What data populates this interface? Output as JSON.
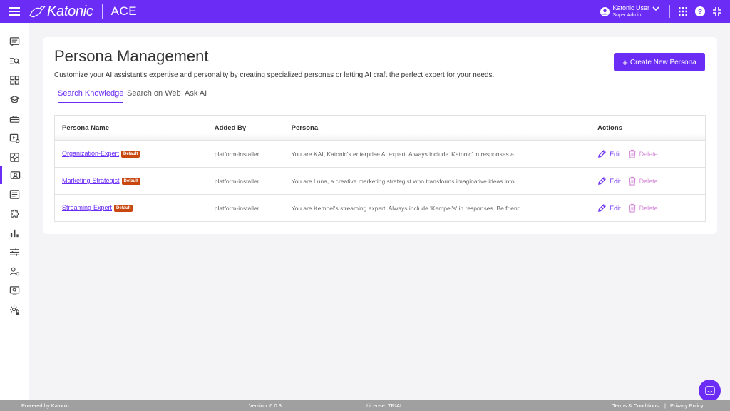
{
  "header": {
    "logo_text": "Katonic",
    "app_name": "ACE",
    "user_name": "Katonic User",
    "user_role": "Super Admin",
    "brand_color": "#6b2cf5"
  },
  "sidebar": {
    "items": [
      {
        "icon": "chat-icon"
      },
      {
        "icon": "search-list-icon"
      },
      {
        "icon": "grid-icon"
      },
      {
        "icon": "graduation-cap-icon"
      },
      {
        "icon": "toolbox-icon"
      },
      {
        "icon": "video-settings-icon"
      },
      {
        "icon": "target-icon"
      },
      {
        "icon": "persona-icon",
        "active": true
      },
      {
        "icon": "document-list-icon"
      },
      {
        "icon": "puzzle-icon"
      },
      {
        "icon": "bar-chart-icon"
      },
      {
        "icon": "sliders-icon"
      },
      {
        "icon": "user-settings-icon"
      },
      {
        "icon": "monitor-search-icon"
      },
      {
        "icon": "gear-lock-icon"
      }
    ]
  },
  "page": {
    "title": "Persona Management",
    "subtitle": "Customize your AI assistant's expertise and personality by creating specialized personas or letting AI craft the perfect expert for your needs.",
    "create_button": "Create New Persona"
  },
  "tabs": [
    {
      "label": "Search Knowledge",
      "active": true
    },
    {
      "label": "Search on Web",
      "active": false
    },
    {
      "label": "Ask AI",
      "active": false
    }
  ],
  "table": {
    "headers": [
      "Persona Name",
      "Added By",
      "Persona",
      "Actions"
    ],
    "rows": [
      {
        "name": "Organization-Expert",
        "badge": "Default",
        "added_by": "platform-installer",
        "persona": "You are KAI, Katonic's enterprise AI expert. Always include 'Katonic' in responses a...",
        "edit": "Edit",
        "delete": "Delete"
      },
      {
        "name": "Marketing-Strategist",
        "badge": "Default",
        "added_by": "platform-installer",
        "persona": "You are Luna, a creative marketing strategist who transforms imaginative ideas into ...",
        "edit": "Edit",
        "delete": "Delete"
      },
      {
        "name": "Streaming-Expert",
        "badge": "Default",
        "added_by": "platform-installer",
        "persona": "You are Kempel's streaming expert. Always include 'Kempel's' in responses. Be friend...",
        "edit": "Edit",
        "delete": "Delete"
      }
    ]
  },
  "footer": {
    "powered_by": "Powered by Katonic",
    "version": "Version: 6.0.3",
    "license": "License: TRIAL",
    "terms": "Terms & Conditions",
    "separator": "|",
    "privacy": "Privacy Policy"
  }
}
